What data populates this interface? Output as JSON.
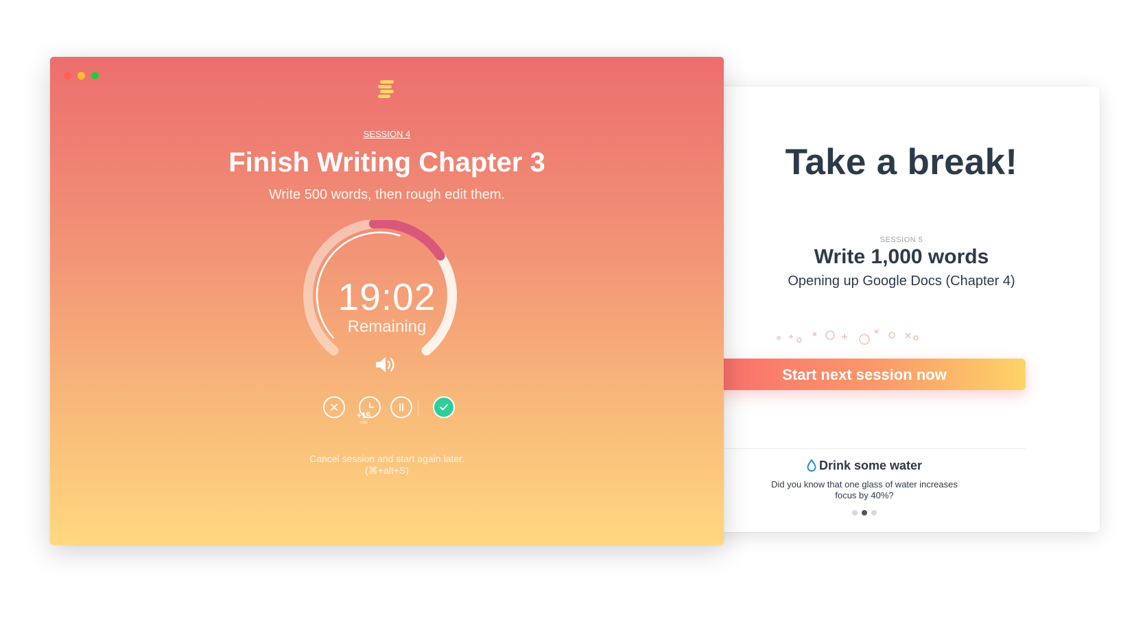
{
  "timer_window": {
    "session_kicker": "SESSION 4",
    "title": "Finish Writing Chapter 3",
    "description": "Write 500 words, then rough edit them.",
    "timer": {
      "value": "19:02",
      "label": "Remaining",
      "progress_elapsed": 0.22
    },
    "controls": {
      "cancel_icon": "close-icon",
      "extend_label": "+15",
      "extend_unit": "min",
      "pause_icon": "pause-icon",
      "done_icon": "check-icon",
      "volume_icon": "speaker-icon"
    },
    "hint_line1": "Cancel session and start again later.",
    "hint_line2": "(⌘+alt+S)"
  },
  "break_window": {
    "title": "Take a break!",
    "next_session_kicker": "SESSION 5",
    "next_session_title": "Write 1,000 words",
    "next_session_desc": "Opening up Google Docs (Chapter 4)",
    "start_button": "Start next session now",
    "tip": {
      "icon": "water-drop-icon",
      "title": "Drink some water",
      "body": "Did you know that one glass of water increases focus by 40%?"
    },
    "pager": {
      "count": 3,
      "active_index": 1
    }
  },
  "colors": {
    "gradient_top": "#ec6e6e",
    "gradient_bottom": "#fed880",
    "done_green": "#2fcc9c",
    "text_dark": "#2c3a4a",
    "water_blue": "#2a8fd6"
  }
}
